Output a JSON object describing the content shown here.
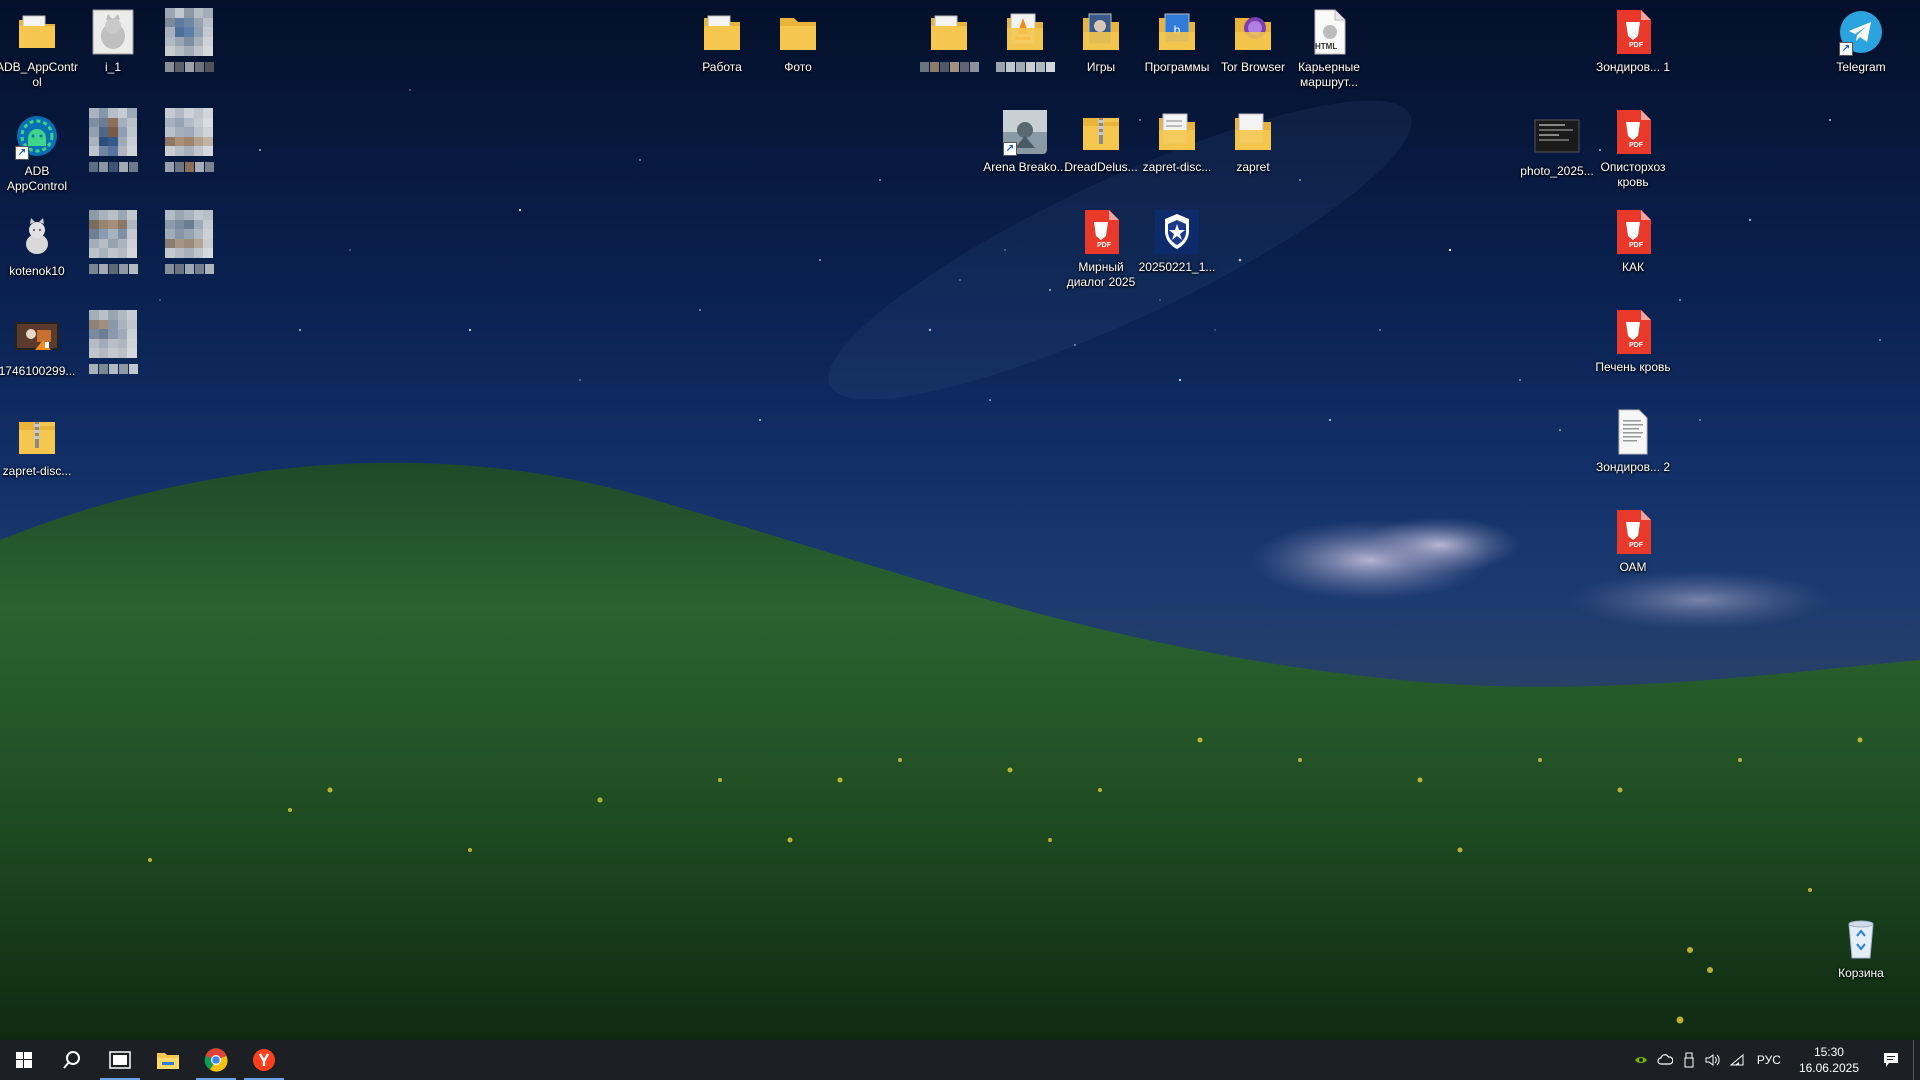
{
  "desktop_icons": {
    "adb_appcontrol_folder": "ADB_AppControl",
    "i_1": "i_1",
    "adb_appcontrol": "ADB AppControl",
    "kotenok10": "kotenok10",
    "video_1746": "1746100299...",
    "zarpet_disc_left": "zapret-disc...",
    "rabota": "Работа",
    "foto": "Фото",
    "igry": "Игры",
    "programmy": "Программы",
    "tor_browser": "Tor Browser",
    "karernye": "Карьерные маршрут...",
    "arena": "Arena Breako...",
    "dreaddelus": "DreadDelus...",
    "zapret_disc_mid": "zapret-disc...",
    "zapret": "zapret",
    "mirnyi_dialog": "Мирный диалог 2025",
    "file_20250221": "20250221_1...",
    "zondirov_1": "Зондиров... 1",
    "photo_2025": "photo_2025...",
    "opistorhoz": "Описторхоз кровь",
    "kak": "КАК",
    "pechen": "Печень кровь",
    "zondirov_2": "Зондиров... 2",
    "oam": "ОАМ",
    "telegram": "Telegram",
    "korzina": "Корзина"
  },
  "icon_labels": {
    "pdf": "PDF",
    "html": "HTML"
  },
  "taskbar": {
    "language": "РУС",
    "time": "15:30",
    "date": "16.06.2025"
  },
  "colors": {
    "pdf_red": "#e8392b",
    "folder_yellow": "#f5c74e",
    "taskbar_bg": "#1c1f24",
    "telegram_blue": "#2aa3df"
  }
}
